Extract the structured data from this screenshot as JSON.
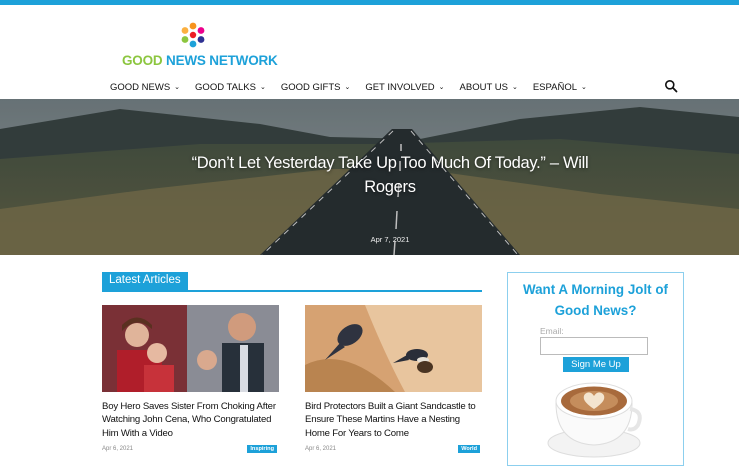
{
  "header": {
    "logo_good": "GOOD ",
    "logo_rest": "NEWS NETWORK"
  },
  "nav": [
    {
      "label": "GOOD NEWS",
      "chevron": "⌄"
    },
    {
      "label": "GOOD TALKS",
      "chevron": "⌄"
    },
    {
      "label": "GOOD GIFTS",
      "chevron": "⌄"
    },
    {
      "label": "GET INVOLVED",
      "chevron": "⌄"
    },
    {
      "label": "ABOUT US",
      "chevron": "⌄"
    },
    {
      "label": "ESPAÑOL",
      "chevron": "⌄"
    }
  ],
  "hero": {
    "quote": "“Don’t Let Yesterday Take Up Too Much Of Today.” – Will Rogers",
    "date": "Apr 7, 2021"
  },
  "latest": {
    "heading": "Latest Articles",
    "articles": [
      {
        "title": "Boy Hero Saves Sister From Choking After Watching John Cena, Who Congratulated Him With a Video",
        "date": "Apr 6, 2021",
        "tag": "Inspiring"
      },
      {
        "title": "Bird Protectors Built a Giant Sandcastle to Ensure These Martins Have a Nesting Home For Years to Come",
        "date": "Apr 6, 2021",
        "tag": "World"
      }
    ]
  },
  "signup": {
    "title": "Want A Morning Jolt of Good News?",
    "email_label": "Email:",
    "button_label": "Sign Me Up"
  },
  "colors": {
    "accent": "#1da1d9",
    "logo_green": "#8cc63f"
  },
  "icons": {
    "search": "search-icon",
    "chevron": "chevron-down-icon"
  }
}
